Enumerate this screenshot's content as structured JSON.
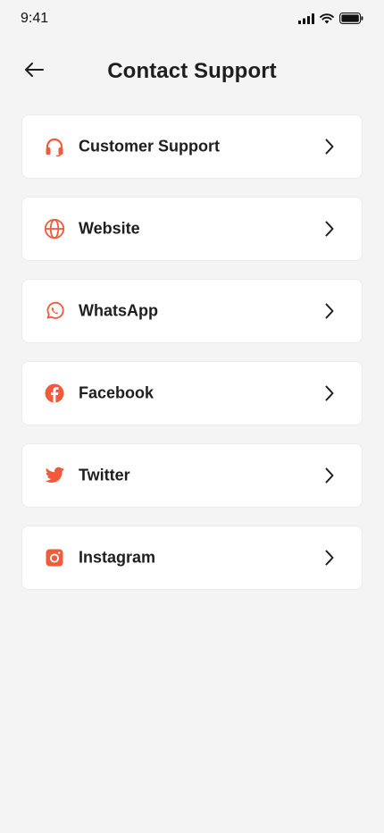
{
  "status_bar": {
    "time": "9:41",
    "icons": [
      "signal-icon",
      "wifi-icon",
      "battery-icon"
    ]
  },
  "header": {
    "title": "Contact Support",
    "back_icon": "arrow-left-icon"
  },
  "colors": {
    "accent": "#f15a3a",
    "background": "#f4f4f4",
    "card": "#ffffff",
    "text": "#1e1e1e"
  },
  "items": [
    {
      "label": "Customer Support",
      "icon": "headset-icon"
    },
    {
      "label": "Website",
      "icon": "globe-icon"
    },
    {
      "label": "WhatsApp",
      "icon": "whatsapp-icon"
    },
    {
      "label": "Facebook",
      "icon": "facebook-icon"
    },
    {
      "label": "Twitter",
      "icon": "twitter-icon"
    },
    {
      "label": "Instagram",
      "icon": "instagram-icon"
    }
  ]
}
